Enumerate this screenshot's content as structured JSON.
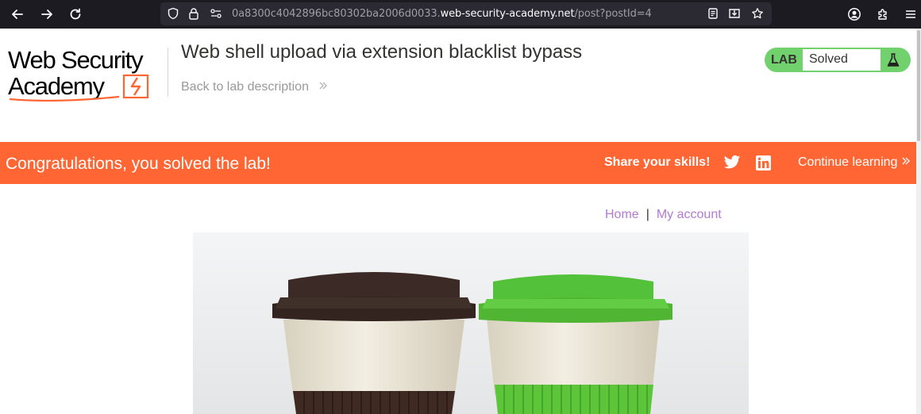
{
  "browser": {
    "url_prefix": "0a8300c4042896bc80302ba2006d0033.",
    "url_host": "web-security-academy.net",
    "url_path": "/post?postId=4"
  },
  "header": {
    "logo_line1": "Web Security",
    "logo_line2": "Academy",
    "title": "Web shell upload via extension blacklist bypass",
    "back_link": "Back to lab description",
    "status_label": "LAB",
    "status_value": "Solved"
  },
  "banner": {
    "message": "Congratulations, you solved the lab!",
    "share_label": "Share your skills!",
    "continue_label": "Continue learning"
  },
  "nav": {
    "home": "Home",
    "separator": "|",
    "account": "My account"
  },
  "colors": {
    "banner_bg": "#ff6633",
    "solved_green": "#70d16d",
    "link_purple": "#b37ad2"
  },
  "icons": [
    "back-arrow-icon",
    "forward-arrow-icon",
    "reload-icon",
    "shield-icon",
    "lock-icon",
    "permissions-icon",
    "reader-view-icon",
    "save-to-pocket-icon",
    "bookmark-star-icon",
    "account-icon",
    "extensions-icon",
    "menu-icon",
    "flask-icon",
    "twitter-icon",
    "linkedin-icon"
  ]
}
